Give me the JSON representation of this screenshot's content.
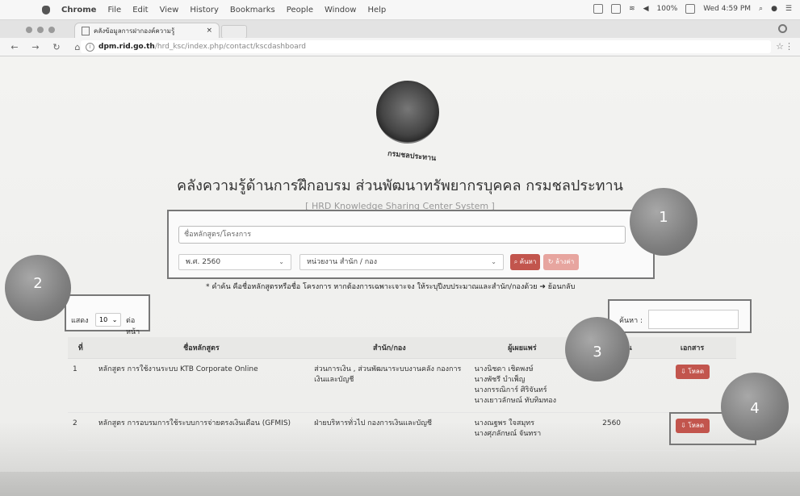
{
  "menubar": {
    "app_name": "Chrome",
    "items": [
      "File",
      "Edit",
      "View",
      "History",
      "Bookmarks",
      "People",
      "Window",
      "Help"
    ],
    "battery": "100%",
    "clock": "Wed 4:59 PM"
  },
  "tab": {
    "title": "คลังข้อมูลการฝากองค์ความรู้",
    "close": "×"
  },
  "address_bar": {
    "host": "dpm.rid.go.th",
    "path": "/hrd_ksc/index.php/contact/kscdashboard"
  },
  "logo": {
    "caption": "กรมชลประทาน"
  },
  "header": {
    "title": "คลังความรู้ด้านการฝึกอบรม ส่วนพัฒนาทรัพยากรบุคคล กรมชลประทาน",
    "subtitle": "[ HRD Knowledge Sharing Center System ]"
  },
  "search": {
    "placeholder": "ชื่อหลักสูตร/โครงการ",
    "year_value": "พ.ศ. 2560",
    "unit_value": "หน่วยงาน สำนัก / กอง",
    "search_label": "ค้นหา",
    "reset_label": "ล้างค่า"
  },
  "note": "* คำค้น คือชื่อหลักสูตรหรือชื่อ โครงการ หากต้องการเฉพาะเจาะจง ให้ระบุปีงบประมาณและสำนัก/กองด้วย ➜ ย้อนกลับ",
  "callouts": [
    "1",
    "2",
    "3",
    "4"
  ],
  "length_control": {
    "show_label": "แสดง",
    "value": "10",
    "suffix": "ต่อหน้า"
  },
  "filter": {
    "label": "ค้นหา :",
    "value": ""
  },
  "table": {
    "columns": [
      "ที่",
      "ชื่อหลักสูตร",
      "สำนัก/กอง",
      "ผู้เผยแพร่",
      "ปีงบประมาณ",
      "เอกสาร"
    ],
    "rows": [
      {
        "no": "1",
        "course": "หลักสูตร การใช้งานระบบ KTB Corporate Online",
        "unit": "ส่วนการเงิน , ส่วนพัฒนาระบบงานคลัง กองการเงินและบัญชี",
        "publishers": "นางนิชดา เชิดพงษ์\nนางพัชรี บำเพ็ญ\nนางกรรณิการ์ ศิริจันทร์\nนางเยาวลักษณ์ ทับทิมทอง",
        "year": "2560",
        "doc_label": "โหลด"
      },
      {
        "no": "2",
        "course": "หลักสูตร การอบรมการใช้ระบบการจ่ายตรงเงินเดือน (GFMIS)",
        "unit": "ฝ่ายบริหารทั่วไป กองการเงินและบัญชี",
        "publishers": "นางณฐพร ใจสมุทร\nนางศุภลักษณ์ จันทรา",
        "year": "2560",
        "doc_label": "โหลด"
      }
    ]
  }
}
